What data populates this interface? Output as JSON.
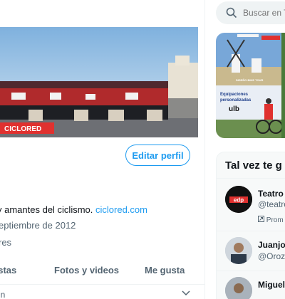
{
  "search": {
    "placeholder": "Buscar en T"
  },
  "profile": {
    "banner_label": "CICLORED",
    "edit_button": "Editar perfil",
    "bio_text": "y amantes del ciclismo. ",
    "bio_link": "ciclored.com",
    "joined": "eptiembre de 2012",
    "following_text": "res"
  },
  "tabs": {
    "replies": "estas",
    "media": "Fotos y videos",
    "likes": "Me gusta"
  },
  "timeline_row": {
    "text": "in"
  },
  "media_preview": {
    "ad_line1": "Equipaciones",
    "ad_line2": "personalizadas",
    "ad_brand": "ulb",
    "ad_banner": "DISEÑO BIKE TOUR"
  },
  "suggestions": {
    "title": "Tal vez te g",
    "items": [
      {
        "name": "Teatro",
        "handle": "@teatro",
        "promo": "Prom",
        "avatar_text": "edp"
      },
      {
        "name": "Juanjo",
        "handle": "@Oroz"
      },
      {
        "name": "Miguel"
      }
    ]
  },
  "colors": {
    "accent": "#1d9bf0",
    "secondary_text": "#536471",
    "banner_red": "#e0312f"
  }
}
